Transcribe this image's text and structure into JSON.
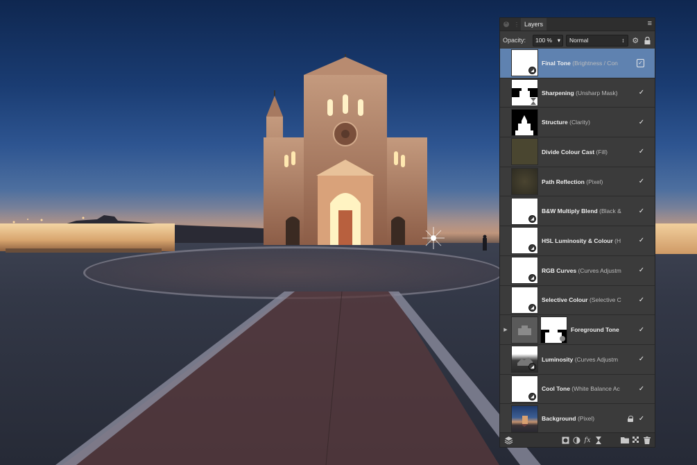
{
  "panel": {
    "tab_label": "Layers",
    "opacity_label": "Opacity:",
    "opacity_value": "100 %",
    "blend_mode": "Normal"
  },
  "layers": [
    {
      "name": "Final Tone",
      "desc": " (Brightness / Con",
      "thumb": "white-adjust",
      "selected": true
    },
    {
      "name": "Sharpening",
      "desc": " (Unsharp Mask)",
      "thumb": "mask-hourglass"
    },
    {
      "name": "Structure",
      "desc": " (Clarity)",
      "thumb": "mask-church"
    },
    {
      "name": "Divide Colour Cast",
      "desc": " (Fill)",
      "thumb": "olive"
    },
    {
      "name": "Path Reflection",
      "desc": " (Pixel)",
      "thumb": "dark-olive"
    },
    {
      "name": "B&W Multiply Blend",
      "desc": " (Black &",
      "thumb": "white-adjust"
    },
    {
      "name": "HSL Luminosity & Colour",
      "desc": " (H",
      "thumb": "white-adjust"
    },
    {
      "name": "RGB Curves",
      "desc": " (Curves Adjustm",
      "thumb": "white-adjust"
    },
    {
      "name": "Selective Colour",
      "desc": " (Selective C",
      "thumb": "white-adjust"
    },
    {
      "name": "Foreground Tone",
      "desc": "",
      "thumb": "group"
    },
    {
      "name": "Luminosity",
      "desc": " (Curves Adjustm",
      "thumb": "luminosity"
    },
    {
      "name": "Cool Tone",
      "desc": " (White Balance Ac",
      "thumb": "white-adjust"
    },
    {
      "name": "Background",
      "desc": " (Pixel)",
      "thumb": "photo",
      "locked": true
    }
  ],
  "colors": {
    "panel_bg": "#3b3b3b",
    "selected_row": "#5f82b0"
  }
}
